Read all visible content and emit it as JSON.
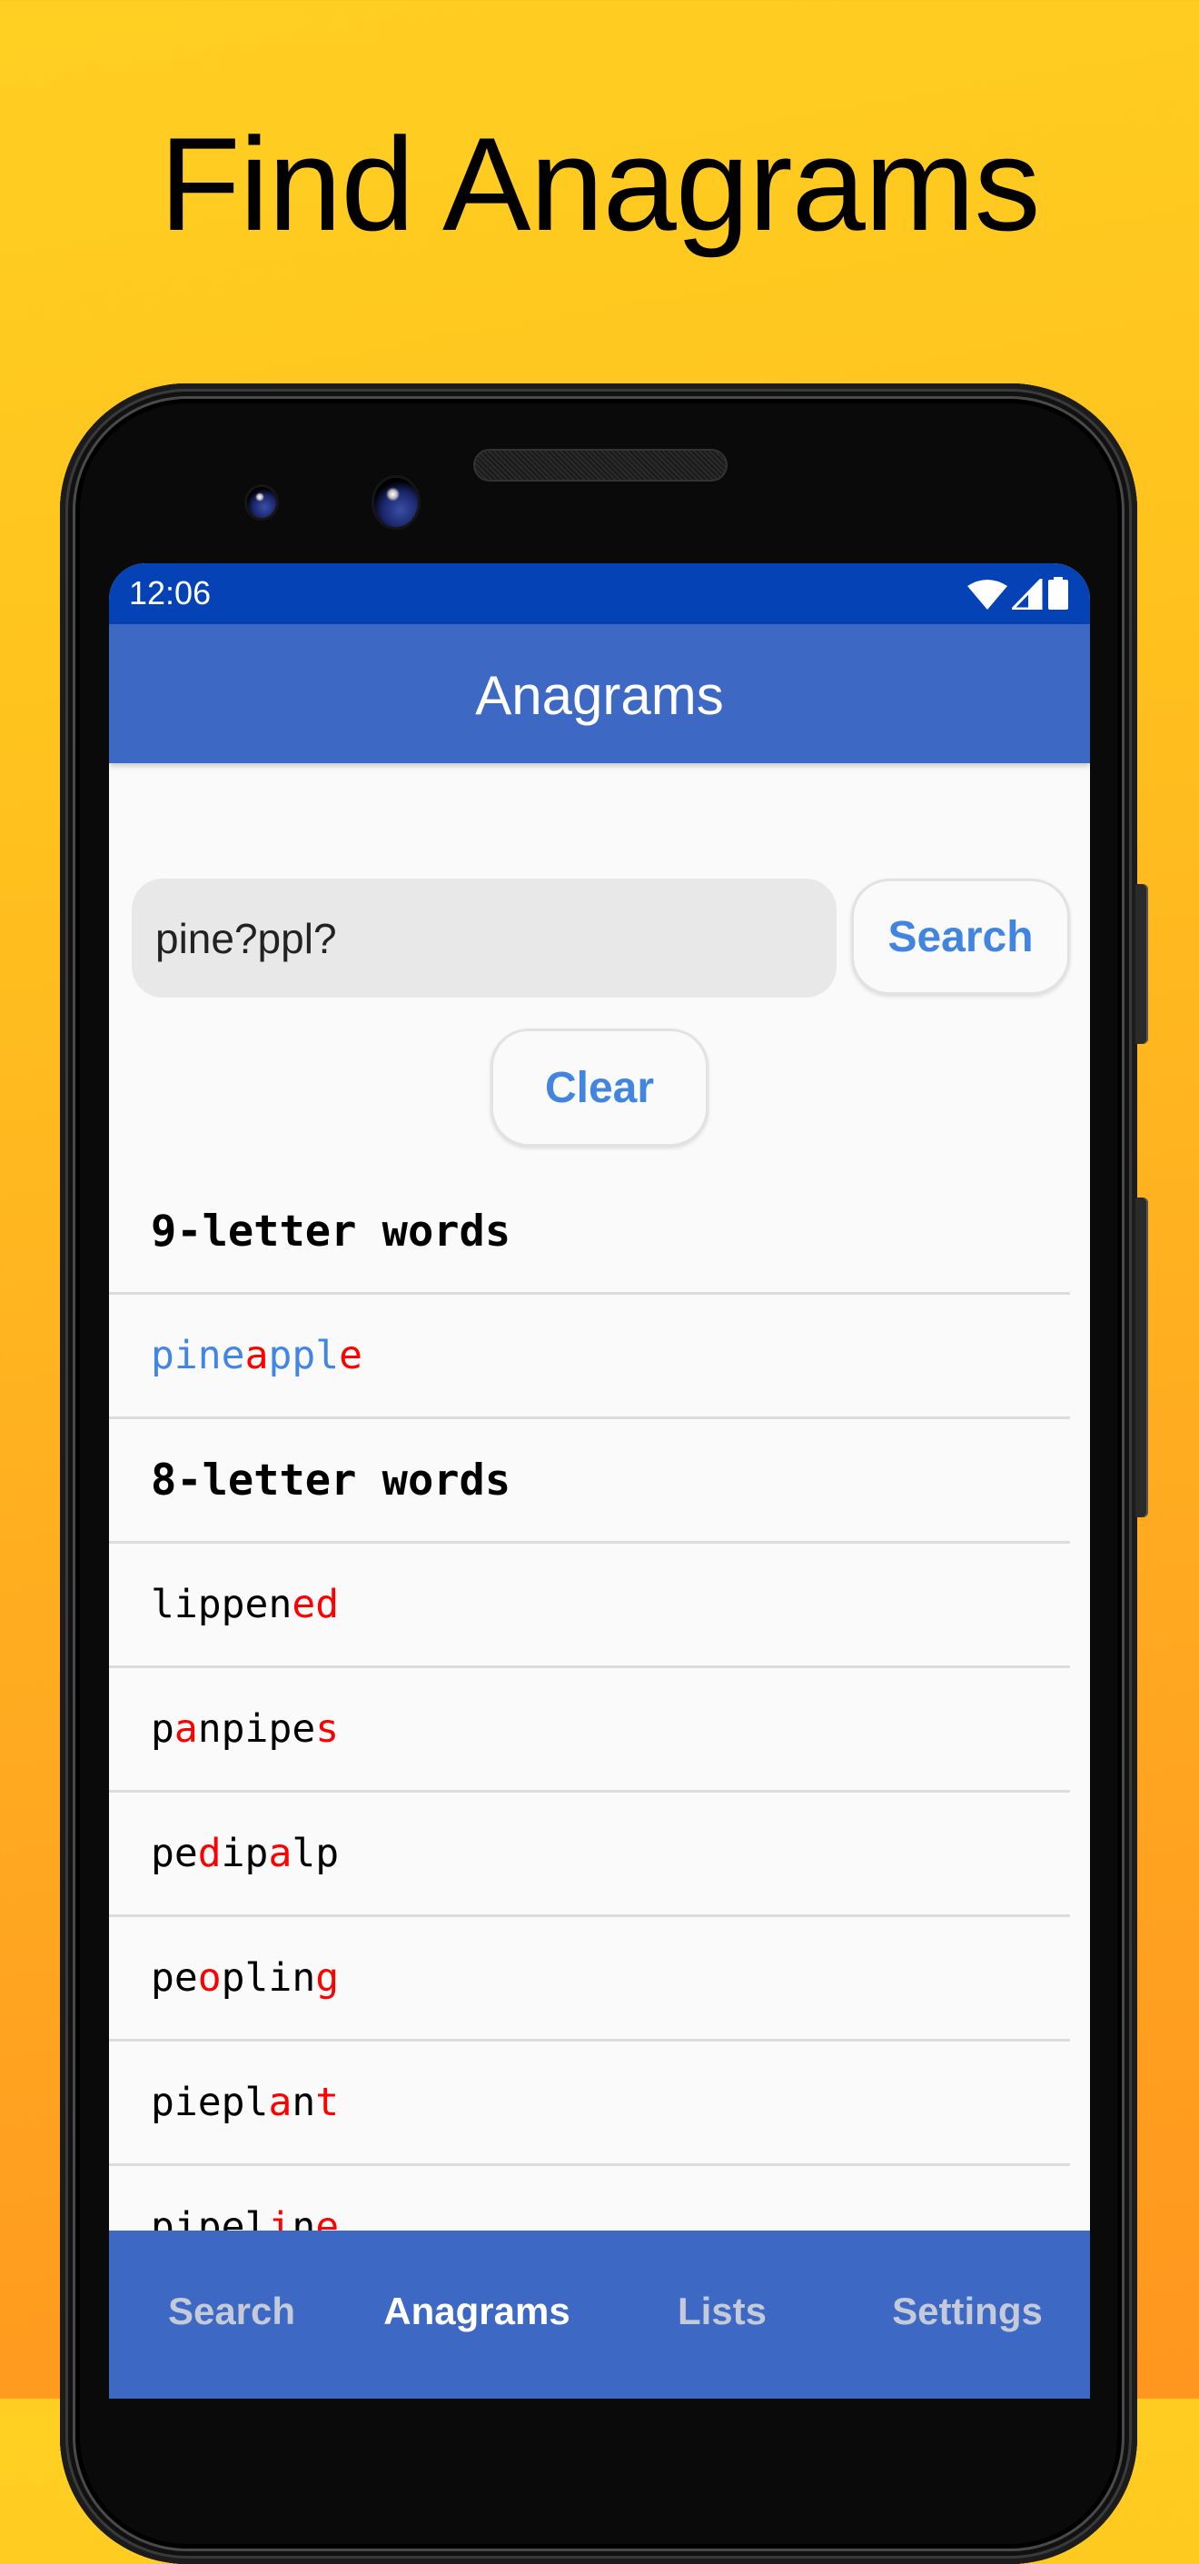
{
  "promo": {
    "title": "Find Anagrams"
  },
  "status_bar": {
    "time": "12:06",
    "icons": [
      "wifi-icon",
      "cell-signal-icon",
      "battery-icon"
    ]
  },
  "app_bar": {
    "title": "Anagrams"
  },
  "search": {
    "input_value": "pine?ppl?",
    "input_placeholder": "",
    "search_label": "Search",
    "clear_label": "Clear"
  },
  "results": [
    {
      "type": "header",
      "text": "9-letter words"
    },
    {
      "type": "word",
      "style": "primary",
      "segments": [
        {
          "t": "pine",
          "hl": false
        },
        {
          "t": "a",
          "hl": true
        },
        {
          "t": "ppl",
          "hl": false
        },
        {
          "t": "e",
          "hl": true
        }
      ]
    },
    {
      "type": "header",
      "text": "8-letter words"
    },
    {
      "type": "word",
      "segments": [
        {
          "t": "lippen",
          "hl": false
        },
        {
          "t": "ed",
          "hl": true
        }
      ]
    },
    {
      "type": "word",
      "segments": [
        {
          "t": "p",
          "hl": false
        },
        {
          "t": "a",
          "hl": true
        },
        {
          "t": "npipe",
          "hl": false
        },
        {
          "t": "s",
          "hl": true
        }
      ]
    },
    {
      "type": "word",
      "segments": [
        {
          "t": "pe",
          "hl": false
        },
        {
          "t": "d",
          "hl": true
        },
        {
          "t": "ip",
          "hl": false
        },
        {
          "t": "a",
          "hl": true
        },
        {
          "t": "lp",
          "hl": false
        }
      ]
    },
    {
      "type": "word",
      "segments": [
        {
          "t": "pe",
          "hl": false
        },
        {
          "t": "o",
          "hl": true
        },
        {
          "t": "plin",
          "hl": false
        },
        {
          "t": "g",
          "hl": true
        }
      ]
    },
    {
      "type": "word",
      "segments": [
        {
          "t": "piepl",
          "hl": false
        },
        {
          "t": "a",
          "hl": true
        },
        {
          "t": "n",
          "hl": false
        },
        {
          "t": "t",
          "hl": true
        }
      ]
    },
    {
      "type": "word",
      "segments": [
        {
          "t": "pipel",
          "hl": false
        },
        {
          "t": "i",
          "hl": true
        },
        {
          "t": "n",
          "hl": false
        },
        {
          "t": "e",
          "hl": true
        }
      ]
    }
  ],
  "bottom_nav": {
    "items": [
      {
        "label": "Search",
        "active": false
      },
      {
        "label": "Anagrams",
        "active": true
      },
      {
        "label": "Lists",
        "active": false
      },
      {
        "label": "Settings",
        "active": false
      }
    ]
  },
  "colors": {
    "background_top": "#FFD022",
    "background_bottom": "#FF961F",
    "status_bar": "#0442B5",
    "app_bar": "#3D68C3",
    "accent_blue": "#4285E0",
    "highlight_red": "#FF0000"
  }
}
